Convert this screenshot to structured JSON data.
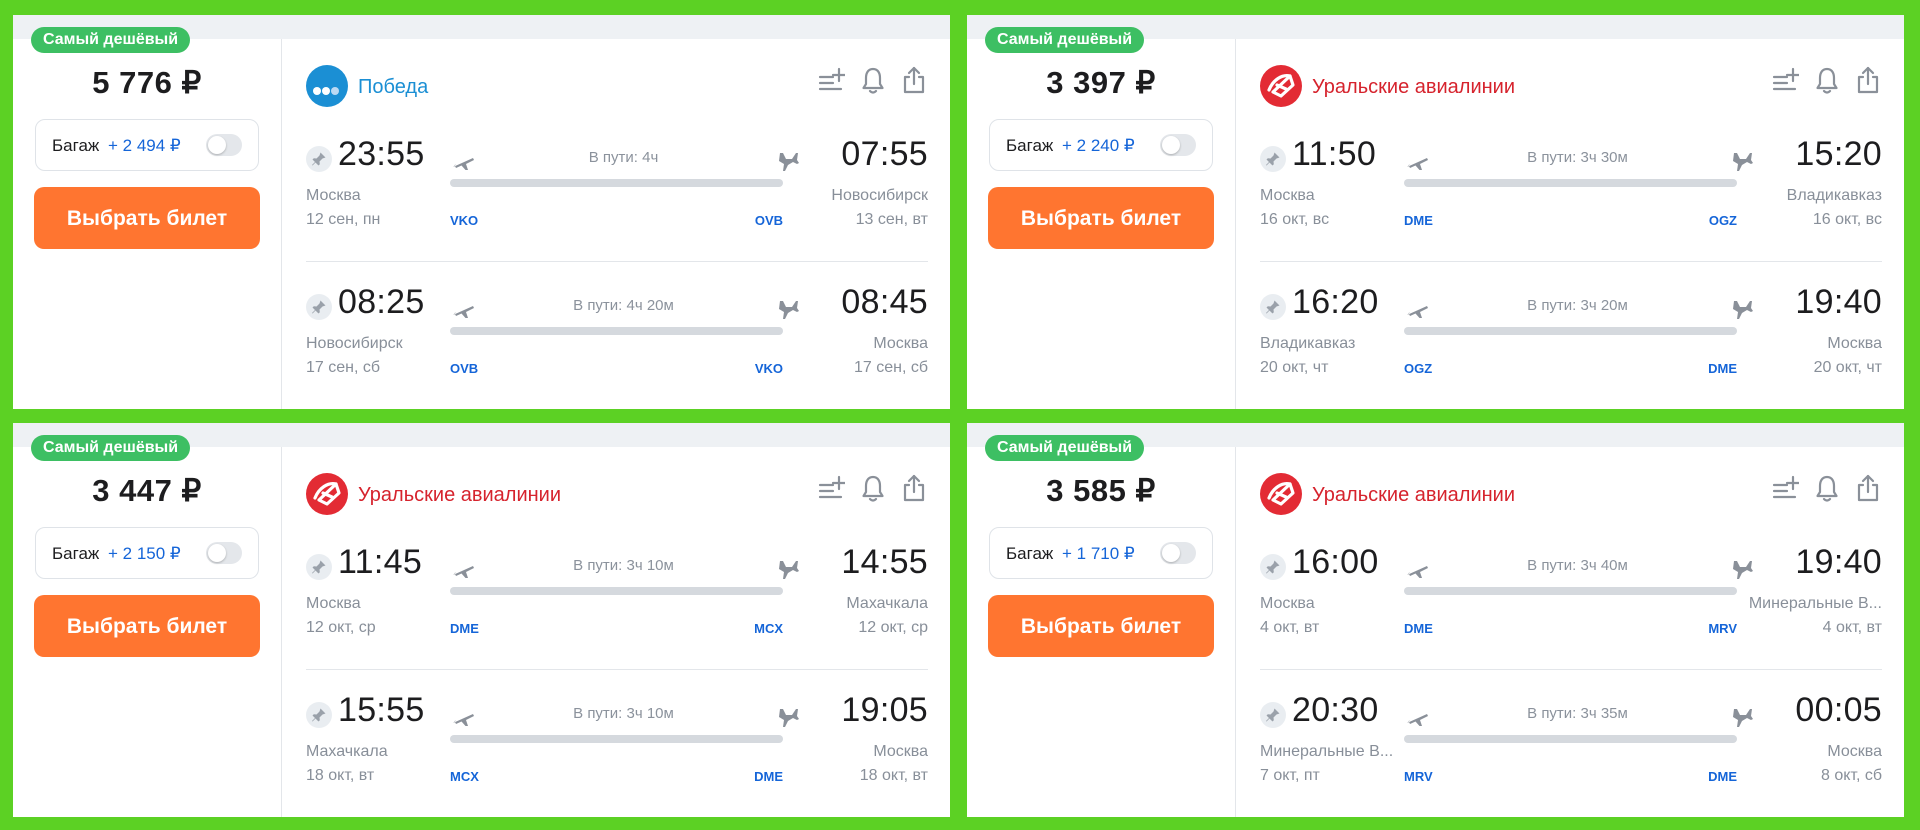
{
  "colors": {
    "background": "#5cd124",
    "accent": "#ff7530",
    "badge": "#3dbf63",
    "link": "#1565d8"
  },
  "cards": [
    {
      "badge": "Самый дешёвый",
      "price": "5 776 ₽",
      "baggage_label": "Багаж",
      "baggage_price": "+ 2 494 ₽",
      "buy_label": "Выбрать билет",
      "airline": {
        "name": "Победа",
        "logo": "pobeda-logo"
      },
      "segments": [
        {
          "dep_time": "23:55",
          "dep_city": "Москва",
          "dep_date": "12 сен, пн",
          "duration": "В пути: 4ч",
          "dep_code": "VKO",
          "arr_code": "OVB",
          "arr_time": "07:55",
          "arr_city": "Новосибирск",
          "arr_date": "13 сен, вт"
        },
        {
          "dep_time": "08:25",
          "dep_city": "Новосибирск",
          "dep_date": "17 сен, сб",
          "duration": "В пути: 4ч 20м",
          "dep_code": "OVB",
          "arr_code": "VKO",
          "arr_time": "08:45",
          "arr_city": "Москва",
          "arr_date": "17 сен, сб"
        }
      ]
    },
    {
      "badge": "Самый дешёвый",
      "price": "3 397 ₽",
      "baggage_label": "Багаж",
      "baggage_price": "+ 2 240 ₽",
      "buy_label": "Выбрать билет",
      "airline": {
        "name": "Уральские авиалинии",
        "logo": "ural-airlines-logo"
      },
      "segments": [
        {
          "dep_time": "11:50",
          "dep_city": "Москва",
          "dep_date": "16 окт, вс",
          "duration": "В пути: 3ч 30м",
          "dep_code": "DME",
          "arr_code": "OGZ",
          "arr_time": "15:20",
          "arr_city": "Владикавказ",
          "arr_date": "16 окт, вс"
        },
        {
          "dep_time": "16:20",
          "dep_city": "Владикавказ",
          "dep_date": "20 окт, чт",
          "duration": "В пути: 3ч 20м",
          "dep_code": "OGZ",
          "arr_code": "DME",
          "arr_time": "19:40",
          "arr_city": "Москва",
          "arr_date": "20 окт, чт"
        }
      ]
    },
    {
      "badge": "Самый дешёвый",
      "price": "3 447 ₽",
      "baggage_label": "Багаж",
      "baggage_price": "+ 2 150 ₽",
      "buy_label": "Выбрать билет",
      "airline": {
        "name": "Уральские авиалинии",
        "logo": "ural-airlines-logo"
      },
      "segments": [
        {
          "dep_time": "11:45",
          "dep_city": "Москва",
          "dep_date": "12 окт, ср",
          "duration": "В пути: 3ч 10м",
          "dep_code": "DME",
          "arr_code": "MCX",
          "arr_time": "14:55",
          "arr_city": "Махачкала",
          "arr_date": "12 окт, ср"
        },
        {
          "dep_time": "15:55",
          "dep_city": "Махачкала",
          "dep_date": "18 окт, вт",
          "duration": "В пути: 3ч 10м",
          "dep_code": "MCX",
          "arr_code": "DME",
          "arr_time": "19:05",
          "arr_city": "Москва",
          "arr_date": "18 окт, вт"
        }
      ]
    },
    {
      "badge": "Самый дешёвый",
      "price": "3 585 ₽",
      "baggage_label": "Багаж",
      "baggage_price": "+ 1 710 ₽",
      "buy_label": "Выбрать билет",
      "airline": {
        "name": "Уральские авиалинии",
        "logo": "ural-airlines-logo"
      },
      "segments": [
        {
          "dep_time": "16:00",
          "dep_city": "Москва",
          "dep_date": "4 окт, вт",
          "duration": "В пути: 3ч 40м",
          "dep_code": "DME",
          "arr_code": "MRV",
          "arr_time": "19:40",
          "arr_city": "Минеральные В...",
          "arr_date": "4 окт, вт"
        },
        {
          "dep_time": "20:30",
          "dep_city": "Минеральные В...",
          "dep_date": "7 окт, пт",
          "duration": "В пути: 3ч 35м",
          "dep_code": "MRV",
          "arr_code": "DME",
          "arr_time": "00:05",
          "arr_city": "Москва",
          "arr_date": "8 окт, сб"
        }
      ]
    }
  ]
}
